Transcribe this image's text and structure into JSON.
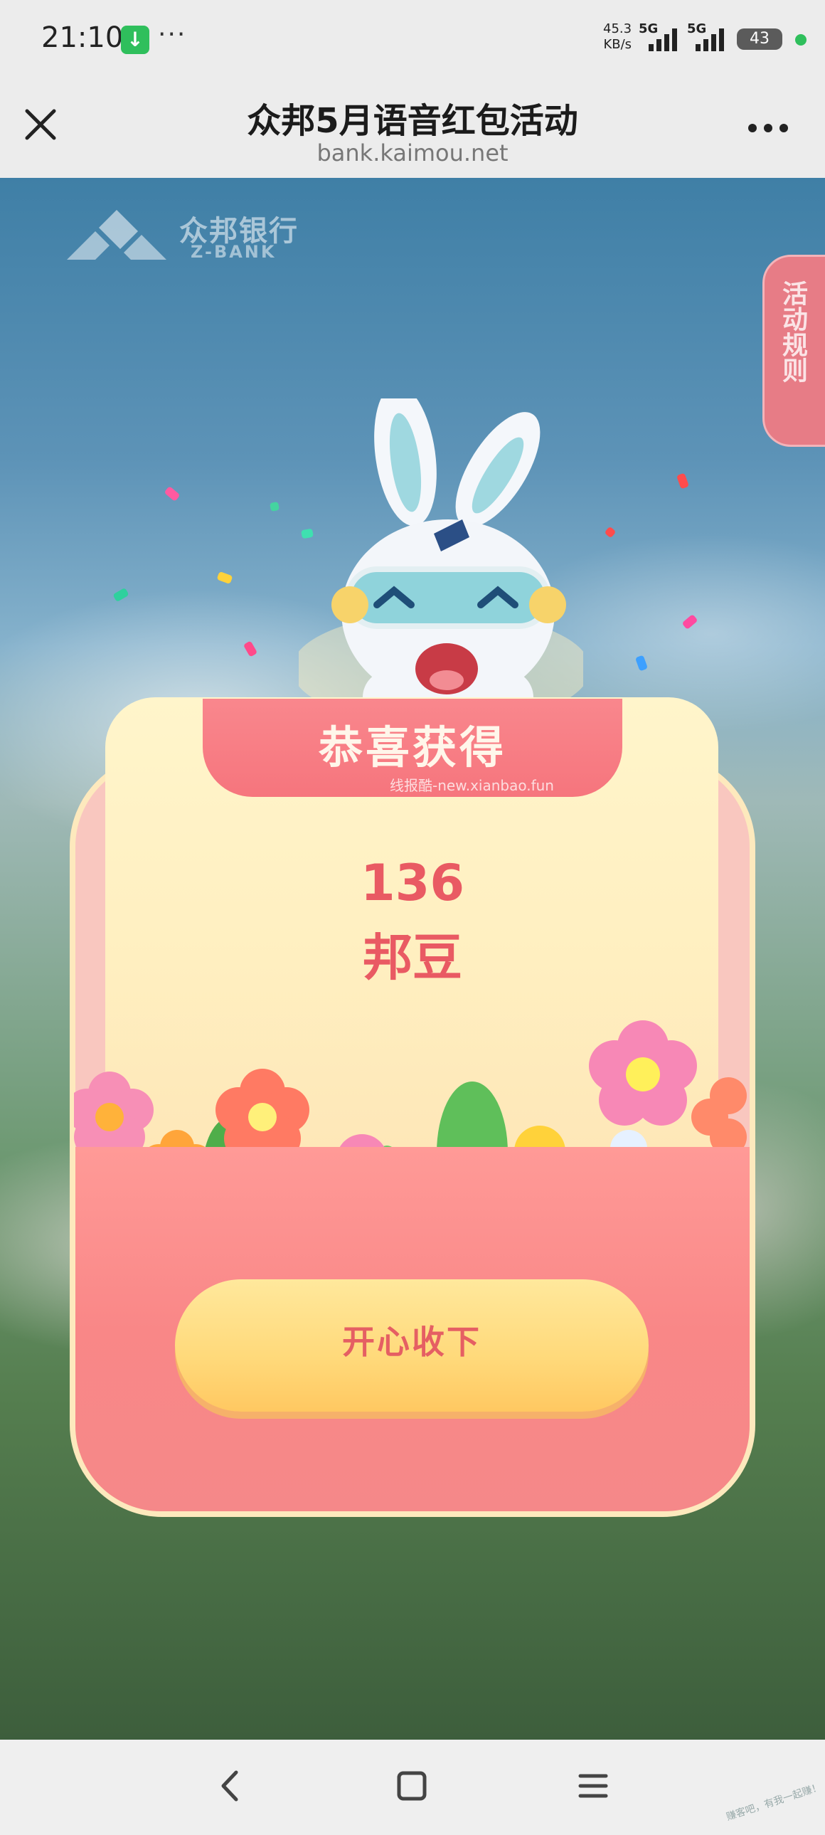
{
  "status_bar": {
    "time": "21:10",
    "download_icon": "arrow-down-icon",
    "more": "···",
    "speed_value": "45.3",
    "speed_unit": "KB/s",
    "network1": "5G",
    "network2": "5G",
    "battery": "43"
  },
  "title_bar": {
    "title": "众邦5月语音红包活动",
    "url": "bank.kaimou.net"
  },
  "brand": {
    "name_cn": "众邦银行",
    "name_en": "Z-BANK"
  },
  "rules_tab": "活动规则",
  "card": {
    "header": "恭喜获得",
    "watermark": "线报酷-new.xianbao.fun",
    "amount": "136",
    "unit": "邦豆",
    "accept_button": "开心收下"
  },
  "corner_watermark": "赚客吧，有我一起赚！",
  "colors": {
    "card_pink": "#f6757d",
    "amount_red": "#e95a63",
    "button_yellow": "#ffd97a",
    "status_green": "#2fbf5c"
  }
}
